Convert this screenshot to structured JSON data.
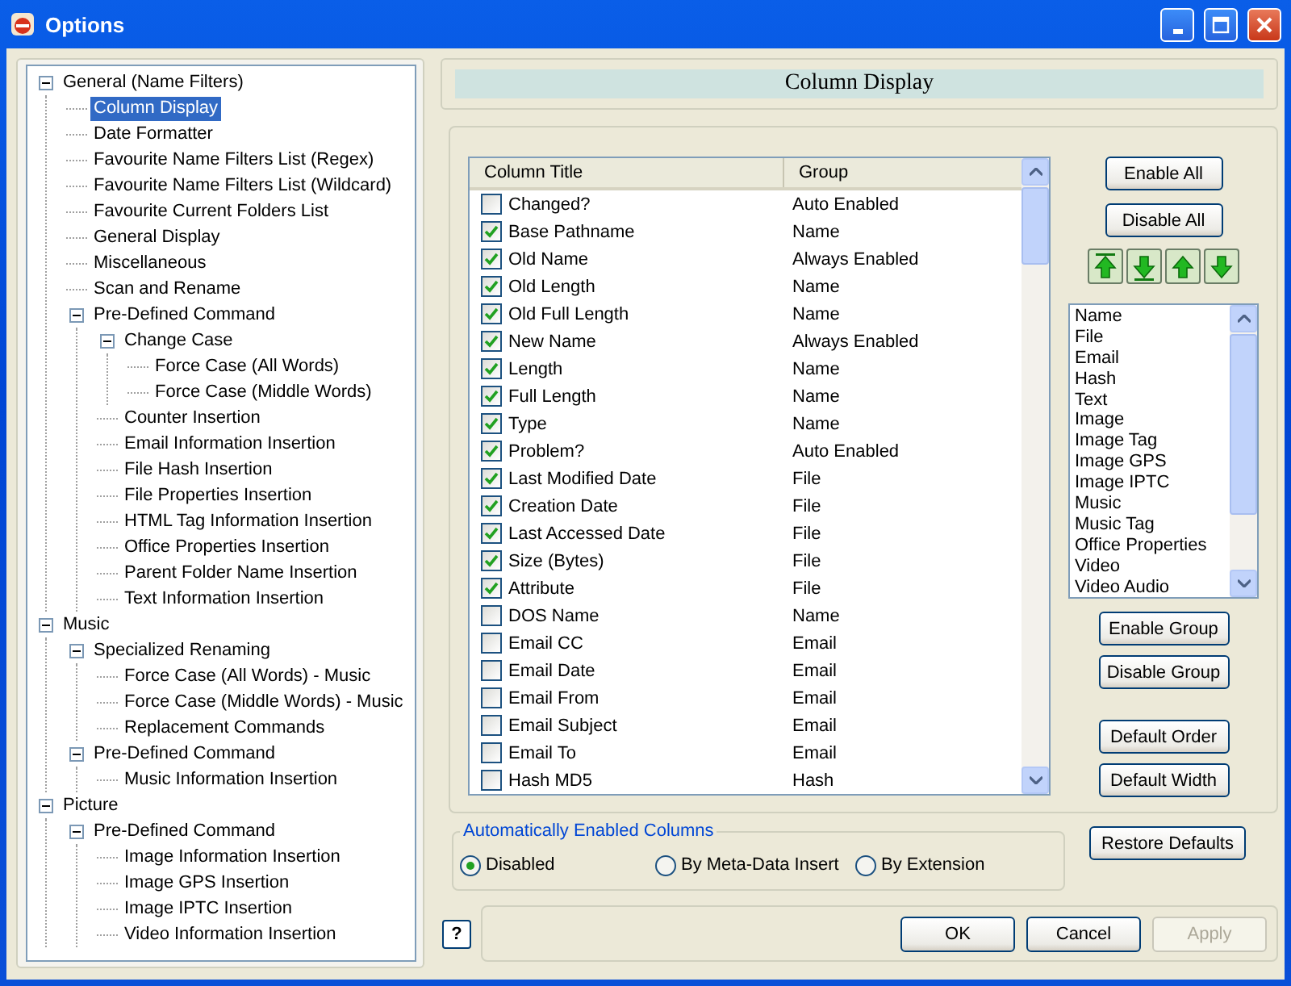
{
  "window": {
    "title": "Options"
  },
  "tree": [
    {
      "label": "General  (Name Filters)",
      "selected": false,
      "expanded": true,
      "children": [
        {
          "label": "Column Display",
          "selected": true
        },
        {
          "label": "Date Formatter",
          "selected": false
        },
        {
          "label": "Favourite Name Filters List (Regex)",
          "selected": false
        },
        {
          "label": "Favourite Name Filters List (Wildcard)",
          "selected": false
        },
        {
          "label": "Favourite Current Folders List",
          "selected": false
        },
        {
          "label": "General Display",
          "selected": false
        },
        {
          "label": "Miscellaneous",
          "selected": false
        },
        {
          "label": "Scan and Rename",
          "selected": false
        },
        {
          "label": "Pre-Defined Command",
          "selected": false,
          "expanded": true,
          "children": [
            {
              "label": "Change Case",
              "selected": false,
              "expanded": true,
              "children": [
                {
                  "label": "Force Case (All Words)",
                  "selected": false
                },
                {
                  "label": "Force Case (Middle Words)",
                  "selected": false
                }
              ]
            },
            {
              "label": "Counter Insertion",
              "selected": false
            },
            {
              "label": "Email Information Insertion",
              "selected": false
            },
            {
              "label": "File Hash Insertion",
              "selected": false
            },
            {
              "label": "File Properties Insertion",
              "selected": false
            },
            {
              "label": "HTML Tag Information Insertion",
              "selected": false
            },
            {
              "label": "Office Properties Insertion",
              "selected": false
            },
            {
              "label": "Parent Folder Name Insertion",
              "selected": false
            },
            {
              "label": "Text Information Insertion",
              "selected": false
            }
          ]
        }
      ]
    },
    {
      "label": "Music",
      "selected": false,
      "expanded": true,
      "children": [
        {
          "label": "Specialized Renaming",
          "selected": false,
          "expanded": true,
          "children": [
            {
              "label": "Force Case (All Words) - Music",
              "selected": false
            },
            {
              "label": "Force Case (Middle Words) - Music",
              "selected": false
            },
            {
              "label": "Replacement Commands",
              "selected": false
            }
          ]
        },
        {
          "label": "Pre-Defined Command",
          "selected": false,
          "expanded": true,
          "children": [
            {
              "label": "Music Information Insertion",
              "selected": false
            }
          ]
        }
      ]
    },
    {
      "label": "Picture",
      "selected": false,
      "expanded": true,
      "children": [
        {
          "label": "Pre-Defined Command",
          "selected": false,
          "expanded": true,
          "children": [
            {
              "label": "Image Information Insertion",
              "selected": false
            },
            {
              "label": "Image GPS Insertion",
              "selected": false
            },
            {
              "label": "Image IPTC Insertion",
              "selected": false
            },
            {
              "label": "Video Information Insertion",
              "selected": false
            }
          ]
        }
      ]
    }
  ],
  "header": {
    "title": "Column Display"
  },
  "table": {
    "columns": [
      "Column Title",
      "Group"
    ],
    "rows": [
      {
        "title": "Changed?",
        "group": "Auto Enabled",
        "checked": false
      },
      {
        "title": "Base Pathname",
        "group": "Name",
        "checked": true
      },
      {
        "title": "Old Name",
        "group": "Always Enabled",
        "checked": true
      },
      {
        "title": "Old Length",
        "group": "Name",
        "checked": true
      },
      {
        "title": "Old Full Length",
        "group": "Name",
        "checked": true
      },
      {
        "title": "New Name",
        "group": "Always Enabled",
        "checked": true
      },
      {
        "title": "Length",
        "group": "Name",
        "checked": true
      },
      {
        "title": "Full Length",
        "group": "Name",
        "checked": true
      },
      {
        "title": "Type",
        "group": "Name",
        "checked": true
      },
      {
        "title": "Problem?",
        "group": "Auto Enabled",
        "checked": true
      },
      {
        "title": "Last Modified Date",
        "group": "File",
        "checked": true
      },
      {
        "title": "Creation Date",
        "group": "File",
        "checked": true
      },
      {
        "title": "Last Accessed Date",
        "group": "File",
        "checked": true
      },
      {
        "title": "Size (Bytes)",
        "group": "File",
        "checked": true
      },
      {
        "title": "Attribute",
        "group": "File",
        "checked": true
      },
      {
        "title": "DOS Name",
        "group": "Name",
        "checked": false
      },
      {
        "title": "Email CC",
        "group": "Email",
        "checked": false
      },
      {
        "title": "Email Date",
        "group": "Email",
        "checked": false
      },
      {
        "title": "Email From",
        "group": "Email",
        "checked": false
      },
      {
        "title": "Email Subject",
        "group": "Email",
        "checked": false
      },
      {
        "title": "Email To",
        "group": "Email",
        "checked": false
      },
      {
        "title": "Hash MD5",
        "group": "Hash",
        "checked": false
      }
    ]
  },
  "top_buttons": [
    "Enable All",
    "Disable All"
  ],
  "groups": [
    "Name",
    "File",
    "Email",
    "Hash",
    "Text",
    "Image",
    "Image Tag",
    "Image GPS",
    "Image IPTC",
    "Music",
    "Music Tag",
    "Office Properties",
    "Video",
    "Video Audio"
  ],
  "group_buttons": [
    "Enable Group",
    "Disable Group"
  ],
  "default_buttons": [
    "Default Order",
    "Default Width"
  ],
  "auto_columns": {
    "legend": "Automatically Enabled Columns",
    "options": [
      {
        "label": "Disabled",
        "selected": true
      },
      {
        "label": "By Meta-Data Insert",
        "selected": false
      },
      {
        "label": "By Extension",
        "selected": false
      }
    ]
  },
  "restore_button": "Restore Defaults",
  "help_button": "?",
  "dialog_buttons": [
    {
      "label": "OK",
      "disabled": false
    },
    {
      "label": "Cancel",
      "disabled": false
    },
    {
      "label": "Apply",
      "disabled": true
    }
  ]
}
